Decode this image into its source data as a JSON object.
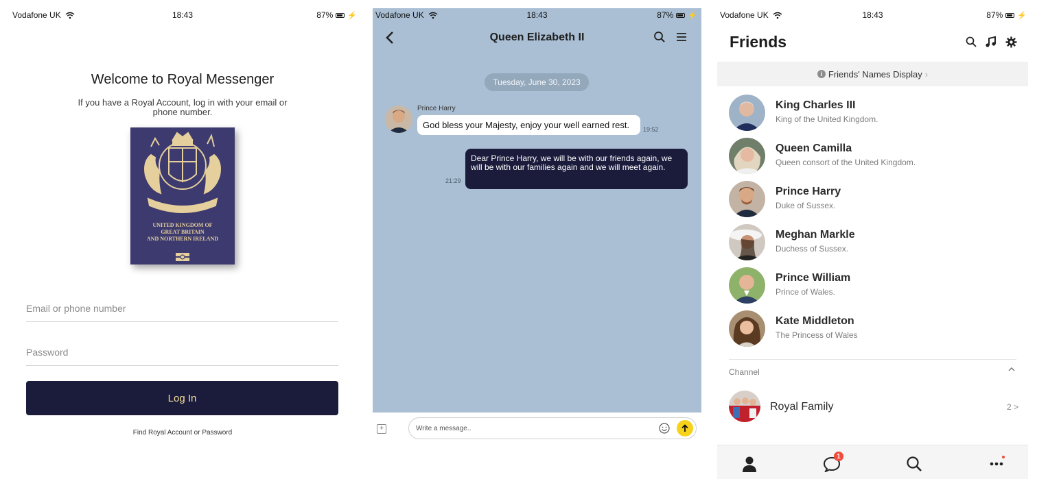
{
  "colors": {
    "navy": "#1b1c3c",
    "gold": "#f5df9a",
    "chat_bg": "#aabfd4",
    "send_yellow": "#f7d21a",
    "badge_red": "#f04a3a",
    "passport_blue": "#3c3a6e"
  },
  "status_bar": {
    "carrier": "Vodafone UK",
    "time": "18:43",
    "battery": "87%",
    "wifi_icon": "wifi-icon",
    "bolt_icon": "charging-bolt-icon"
  },
  "login": {
    "welcome": "Welcome to Royal Messenger",
    "subtitle": "If you have a Royal Account, log in with your email or phone number.",
    "passport_lines": [
      "UNITED KINGDOM OF",
      "GREAT BRITAIN",
      "AND NORTHERN IRELAND"
    ],
    "email_placeholder": "Email or phone number",
    "password_placeholder": "Password",
    "login_label": "Log In",
    "find_link": "Find Royal Account or Password"
  },
  "chat": {
    "title": "Queen Elizabeth II",
    "back_icon": "chevron-left-icon",
    "date": "Tuesday, June 30, 2023",
    "messages": [
      {
        "sender": "Prince Harry",
        "text": "God bless your Majesty, enjoy your well earned rest.",
        "time": "19:52",
        "direction": "in"
      },
      {
        "text": "Dear Prince Harry, we will be with our friends again, we will be with our families again and we will meet again.",
        "time": "21:29",
        "direction": "out"
      }
    ],
    "input_placeholder": "Write a message.."
  },
  "friends": {
    "title": "Friends",
    "names_display": "Friends' Names Display",
    "list": [
      {
        "name": "King Charles III",
        "desc": "King of the United Kingdom."
      },
      {
        "name": "Queen Camilla",
        "desc": "Queen consort of the United Kingdom."
      },
      {
        "name": "Prince Harry",
        "desc": "Duke of Sussex."
      },
      {
        "name": "Meghan Markle",
        "desc": "Duchess of Sussex."
      },
      {
        "name": "Prince William",
        "desc": "Prince of Wales."
      },
      {
        "name": "Kate Middleton",
        "desc": "The Princess of Wales"
      }
    ],
    "channel_label": "Channel",
    "channel": {
      "name": "Royal Family",
      "count": "2 >"
    },
    "tabs": {
      "chat_badge": "1"
    }
  }
}
